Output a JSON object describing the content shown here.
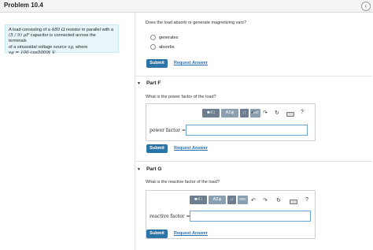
{
  "header": {
    "title": "Problem 10.4",
    "nav_icon": "‹"
  },
  "problem": {
    "line1a": "A load consisting of a ",
    "line1_res": "480 Ω",
    "line1b": " resistor in parallel with a",
    "line2_cap": "(5 / 9) μF",
    "line2b": " capacitor is connected across the terminals",
    "line3a": "of a sinusoidal voltage source ",
    "line3_vg": "vg",
    "line3b": ", where",
    "line4": "vg = 100 cos5000t V."
  },
  "part_e": {
    "question": "Does the load absorb or generate magnetizing vars?",
    "options": [
      "generates",
      "absorbs"
    ],
    "submit": "Submit",
    "request": "Request Answer"
  },
  "part_f": {
    "title": "Part F",
    "question": "What is the power factor of the load?",
    "toolbar": {
      "templates": "■√□",
      "greek": "ΑΣφ",
      "arrows": "↓↑",
      "vec": "vec",
      "help": "?"
    },
    "field_label": "power factor =",
    "field_value": "",
    "submit": "Submit",
    "request": "Request Answer"
  },
  "part_g": {
    "title": "Part G",
    "question": "What is the reactive factor of the load?",
    "toolbar": {
      "templates": "■√□",
      "greek": "ΑΣφ",
      "arrows": "↓↑",
      "vec": "vec",
      "help": "?"
    },
    "field_label": "reactive factor =",
    "field_value": "",
    "submit": "Submit",
    "request": "Request Answer"
  },
  "icons": {
    "undo": "↶",
    "redo": "↷",
    "reset": "↻",
    "keyboard": "keyboard-icon"
  }
}
